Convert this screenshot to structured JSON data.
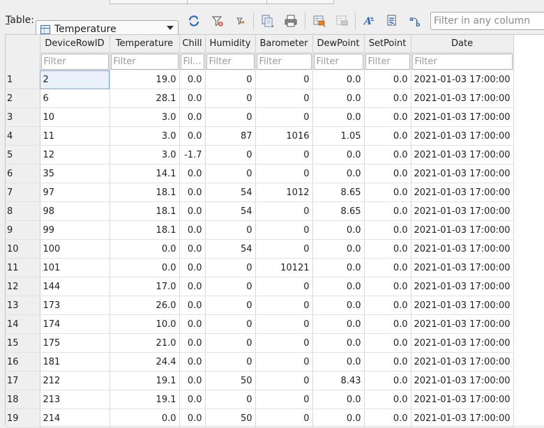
{
  "toolbar": {
    "table_label_prefix": "T",
    "table_label_rest": "able:",
    "table_value": "Temperature",
    "filter_all_placeholder": "Filter in any column",
    "icons": [
      "refresh-icon",
      "clear-filter-icon",
      "save-filter-icon",
      "copy-create-icon",
      "print-icon",
      "insert-record-icon",
      "delete-record-icon",
      "find-icon",
      "export-icon",
      "replace-icon"
    ]
  },
  "grid": {
    "columns": [
      "DeviceRowID",
      "Temperature",
      "Chill",
      "Humidity",
      "Barometer",
      "DewPoint",
      "SetPoint",
      "Date"
    ],
    "filter_placeholders": [
      "Filter",
      "Filter",
      "Fil...",
      "Filter",
      "Filter",
      "Filter",
      "Filter",
      "Filter"
    ],
    "rows": [
      {
        "n": "1",
        "c": [
          "2",
          "19.0",
          "0.0",
          "0",
          "0",
          "0.0",
          "0.0",
          "2021-01-03 17:00:00"
        ]
      },
      {
        "n": "2",
        "c": [
          "6",
          "28.1",
          "0.0",
          "0",
          "0",
          "0.0",
          "0.0",
          "2021-01-03 17:00:00"
        ]
      },
      {
        "n": "3",
        "c": [
          "10",
          "3.0",
          "0.0",
          "0",
          "0",
          "0.0",
          "0.0",
          "2021-01-03 17:00:00"
        ]
      },
      {
        "n": "4",
        "c": [
          "11",
          "3.0",
          "0.0",
          "87",
          "1016",
          "1.05",
          "0.0",
          "2021-01-03 17:00:00"
        ]
      },
      {
        "n": "5",
        "c": [
          "12",
          "3.0",
          "-1.7",
          "0",
          "0",
          "0.0",
          "0.0",
          "2021-01-03 17:00:00"
        ]
      },
      {
        "n": "6",
        "c": [
          "35",
          "14.1",
          "0.0",
          "0",
          "0",
          "0.0",
          "0.0",
          "2021-01-03 17:00:00"
        ]
      },
      {
        "n": "7",
        "c": [
          "97",
          "18.1",
          "0.0",
          "54",
          "1012",
          "8.65",
          "0.0",
          "2021-01-03 17:00:00"
        ]
      },
      {
        "n": "8",
        "c": [
          "98",
          "18.1",
          "0.0",
          "54",
          "0",
          "8.65",
          "0.0",
          "2021-01-03 17:00:00"
        ]
      },
      {
        "n": "9",
        "c": [
          "99",
          "18.1",
          "0.0",
          "0",
          "0",
          "0.0",
          "0.0",
          "2021-01-03 17:00:00"
        ]
      },
      {
        "n": "10",
        "c": [
          "100",
          "0.0",
          "0.0",
          "54",
          "0",
          "0.0",
          "0.0",
          "2021-01-03 17:00:00"
        ]
      },
      {
        "n": "11",
        "c": [
          "101",
          "0.0",
          "0.0",
          "0",
          "10121",
          "0.0",
          "0.0",
          "2021-01-03 17:00:00"
        ]
      },
      {
        "n": "12",
        "c": [
          "144",
          "17.0",
          "0.0",
          "0",
          "0",
          "0.0",
          "0.0",
          "2021-01-03 17:00:00"
        ]
      },
      {
        "n": "13",
        "c": [
          "173",
          "26.0",
          "0.0",
          "0",
          "0",
          "0.0",
          "0.0",
          "2021-01-03 17:00:00"
        ]
      },
      {
        "n": "14",
        "c": [
          "174",
          "10.0",
          "0.0",
          "0",
          "0",
          "0.0",
          "0.0",
          "2021-01-03 17:00:00"
        ]
      },
      {
        "n": "15",
        "c": [
          "175",
          "21.0",
          "0.0",
          "0",
          "0",
          "0.0",
          "0.0",
          "2021-01-03 17:00:00"
        ]
      },
      {
        "n": "16",
        "c": [
          "181",
          "24.4",
          "0.0",
          "0",
          "0",
          "0.0",
          "0.0",
          "2021-01-03 17:00:00"
        ]
      },
      {
        "n": "17",
        "c": [
          "212",
          "19.1",
          "0.0",
          "50",
          "0",
          "8.43",
          "0.0",
          "2021-01-03 17:00:00"
        ]
      },
      {
        "n": "18",
        "c": [
          "213",
          "19.1",
          "0.0",
          "0",
          "0",
          "0.0",
          "0.0",
          "2021-01-03 17:00:00"
        ]
      },
      {
        "n": "19",
        "c": [
          "214",
          "0.0",
          "0.0",
          "50",
          "0",
          "0.0",
          "0.0",
          "2021-01-03 17:00:00"
        ]
      }
    ],
    "selected_cell": {
      "row": 0,
      "col": 0
    }
  }
}
